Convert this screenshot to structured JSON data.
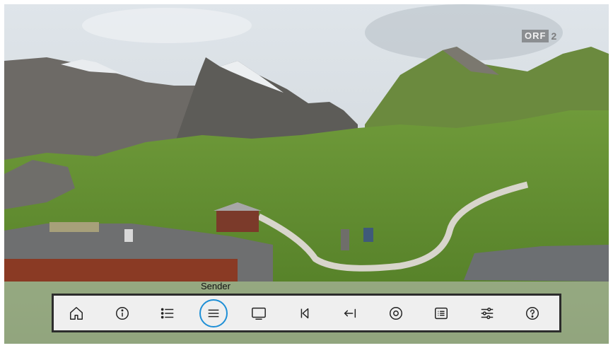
{
  "channel_logo": {
    "text": "ORF",
    "number": "2"
  },
  "tooltip": "Sender",
  "toolbar": {
    "buttons": [
      {
        "name": "home-button",
        "icon": "home-icon"
      },
      {
        "name": "info-button",
        "icon": "info-icon"
      },
      {
        "name": "list-button",
        "icon": "bullet-list-icon"
      },
      {
        "name": "channels-button",
        "icon": "hamburger-menu-icon",
        "focused": true
      },
      {
        "name": "screen-button",
        "icon": "tv-screen-icon"
      },
      {
        "name": "skip-back-button",
        "icon": "skip-back-icon"
      },
      {
        "name": "back-button",
        "icon": "arrow-left-bar-icon"
      },
      {
        "name": "record-button",
        "icon": "record-icon"
      },
      {
        "name": "guide-button",
        "icon": "guide-list-icon"
      },
      {
        "name": "settings-button",
        "icon": "sliders-icon"
      },
      {
        "name": "help-button",
        "icon": "help-icon"
      }
    ]
  },
  "colors": {
    "focus": "#1e8fd6",
    "toolbar_border": "#2c2c2c",
    "icon": "#222222"
  }
}
